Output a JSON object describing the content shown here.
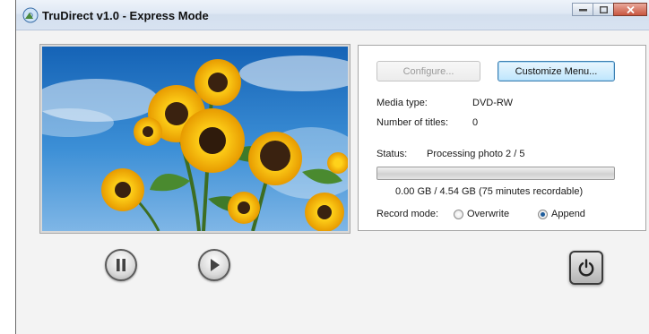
{
  "window": {
    "title": "TruDirect v1.0 - Express Mode"
  },
  "buttons": {
    "configure": "Configure...",
    "customize_menu": "Customize Menu..."
  },
  "media": {
    "type_label": "Media type:",
    "type_value": "DVD-RW",
    "titles_label": "Number of titles:",
    "titles_value": "0"
  },
  "status": {
    "label": "Status:",
    "value": "Processing photo 2 / 5",
    "progress_fraction": 0.0,
    "capacity": "0.00 GB / 4.54 GB (75 minutes recordable)"
  },
  "record_mode": {
    "label": "Record mode:",
    "options": [
      "Overwrite",
      "Append"
    ],
    "selected": "Append"
  },
  "icons": [
    "app-icon",
    "minimize-icon",
    "maximize-icon",
    "close-icon",
    "pause-icon",
    "play-icon",
    "power-icon"
  ],
  "colors": {
    "titlebar": "#dfe8f4",
    "panel_border": "#a6a6a6",
    "focus_border": "#3c7fb1"
  }
}
